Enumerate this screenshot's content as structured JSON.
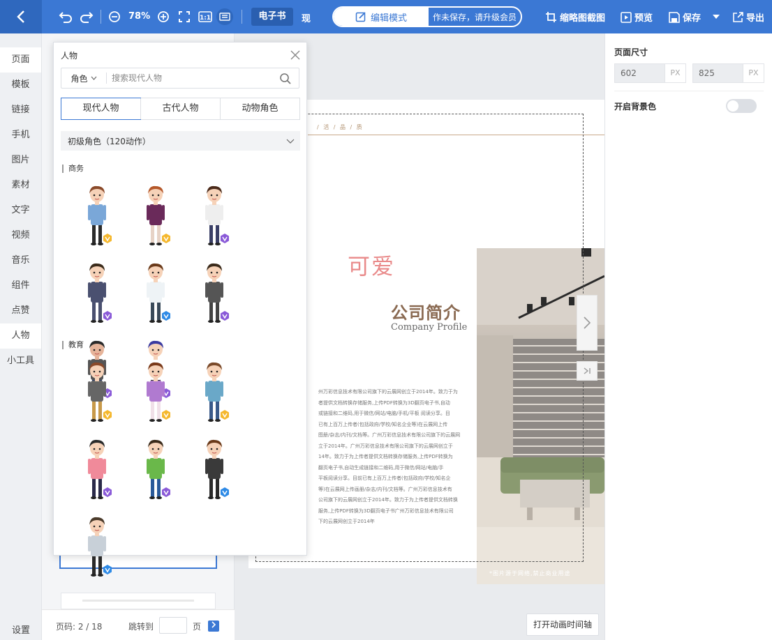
{
  "toolbar": {
    "zoom": "78%",
    "ebook_tab": "电子书",
    "now_tab": "现",
    "mode_edit": "编辑模式",
    "mode_status": "作未保存，请升级会员",
    "thumbnail_capture": "缩略图截图",
    "preview": "预览",
    "save": "保存",
    "export": "导出"
  },
  "left_nav": {
    "items": [
      "页面",
      "模板",
      "链接",
      "手机",
      "图片",
      "素材",
      "文字",
      "视频",
      "音乐",
      "组件",
      "点赞",
      "人物",
      "小工具"
    ],
    "settings": "设置"
  },
  "pager": {
    "info": "页码: 2 / 18",
    "jump_label": "跳转到",
    "page_unit": "页"
  },
  "canvas": {
    "breadcrumb": "/ 活 / 品 / 质",
    "cute_text": "可爱",
    "title": "公司简介",
    "subtitle": "Company Profile",
    "body_lines": [
      "州万彩信息技术有限公司旗下的云展网创立于2014年。致力于为",
      "者提供文档转换存储服务,上传PDF转换为3D翻页电子书,自动",
      "或链接和二维码,用于微信/网站/电脑/手机/平板 阅读分享。目",
      "已有上百万上传者(包括政府/学校/知名企业等)在云展网上传",
      "图册/杂志/内刊/文档等。广州万彩信息技术有限公司旗下的云展网",
      "立于2014年。广州万彩信息技术有限公司旗下的云展网创立于",
      "14年。致力于为上传者提供文档转换存储服务,上传PDF转换为",
      "翻页电子书,自动生成链接和二维码,用于微信/网站/电脑/手",
      "平板阅读分享。目前已有上百万上传者(包括政府/学校/知名企",
      "等)在云展网上传画册/杂志/内刊/文档等。广州万彩信息技术有",
      "公司旗下的云展网创立于2014年。致力于为上传者提供文档转换",
      "服务,上传PDF转换为3D翻页电子书广州万彩信息技术有限公司",
      "下的云展网创立于2014年"
    ],
    "photo_caption": "*图片源于网络,禁止商业用途",
    "timeline_button": "打开动画时间轴"
  },
  "right_panel": {
    "size_label": "页面尺寸",
    "width": "602",
    "height": "825",
    "unit": "PX",
    "bg_label": "开启背景色",
    "bg_enabled": false
  },
  "popup": {
    "title": "人物",
    "role_select": "角色",
    "search_placeholder": "搜索现代人物",
    "tabs": [
      "现代人物",
      "古代人物",
      "动物角色"
    ],
    "active_tab": 0,
    "level": "初级角色（120动作）",
    "sections": [
      {
        "title": "商务",
        "characters": [
          {
            "name": "business-man-blue-shirt",
            "hair": "#8a4a2a",
            "skin": "#f6d2b8",
            "top": "#7aa7d8",
            "bottom": "#2b2b2b",
            "badge": "gold"
          },
          {
            "name": "business-woman-long-hair",
            "hair": "#b5582a",
            "skin": "#f6d2b8",
            "top": "#6a2a5a",
            "bottom": "#e7d3c6",
            "badge": "gold"
          },
          {
            "name": "business-woman-ponytail",
            "hair": "#4a2a1a",
            "skin": "#f6d2b8",
            "top": "#eeeeee",
            "bottom": "#3a3f66",
            "badge": "purple"
          },
          {
            "name": "business-man-suit",
            "hair": "#3a2a1a",
            "skin": "#f6d2b8",
            "top": "#4a5070",
            "bottom": "#4a5070",
            "badge": "purple"
          },
          {
            "name": "business-woman-glasses",
            "hair": "#6a3a1a",
            "skin": "#f6d2b8",
            "top": "#eef3f6",
            "bottom": "#3a4a5a",
            "badge": "blue"
          },
          {
            "name": "business-man-grey-suit",
            "hair": "#3a2a1a",
            "skin": "#f6d2b8",
            "top": "#555555",
            "bottom": "#444444",
            "badge": "purple"
          },
          {
            "name": "business-man-red-tie",
            "hair": "#2a2a2a",
            "skin": "#e6b49a",
            "top": "#555555",
            "bottom": "#2a3a66",
            "badge": "purple"
          },
          {
            "name": "business-woman-blue-hair",
            "hair": "#3a3aa0",
            "skin": "#f6d2b8",
            "top": "#ffffff",
            "bottom": "#2a2a2a",
            "badge": "purple"
          }
        ]
      },
      {
        "title": "教育",
        "characters": [
          {
            "name": "teacher-man-glasses",
            "hair": "#8a4a2a",
            "skin": "#f6d2b8",
            "top": "#666666",
            "bottom": "#c89a4a",
            "badge": "gold"
          },
          {
            "name": "teacher-woman-purple",
            "hair": "#7a3a1a",
            "skin": "#f6d2b8",
            "top": "#b07ad0",
            "bottom": "#f0e0e8",
            "badge": "gold"
          },
          {
            "name": "student-boy-backpack",
            "hair": "#7a4a2a",
            "skin": "#f6d2b8",
            "top": "#6aa8c8",
            "bottom": "#3a5a8a",
            "badge": "gold"
          },
          {
            "name": "student-boy-pink-shirt",
            "hair": "#2a2a2a",
            "skin": "#f6d2b8",
            "top": "#f08a9a",
            "bottom": "#2a2a4a",
            "badge": "purple"
          },
          {
            "name": "teacher-woman-green",
            "hair": "#3a2a1a",
            "skin": "#f6d2b8",
            "top": "#6ab84a",
            "bottom": "#2a5a9a",
            "badge": "purple"
          },
          {
            "name": "teacher-woman-suit",
            "hair": "#6a3a1a",
            "skin": "#f6d2b8",
            "top": "#3a3a3a",
            "bottom": "#2a2a2a",
            "badge": "blue"
          },
          {
            "name": "teacher-man-white-coat",
            "hair": "#4a3a2a",
            "skin": "#f6d2b8",
            "top": "#c8d0d8",
            "bottom": "#2a2a2a",
            "badge": "blue"
          }
        ]
      }
    ]
  },
  "colors": {
    "brand": "#3b78d4",
    "badge_gold": "#f5b82e",
    "badge_purple": "#8a5ad8",
    "badge_blue": "#2e8ae6"
  }
}
